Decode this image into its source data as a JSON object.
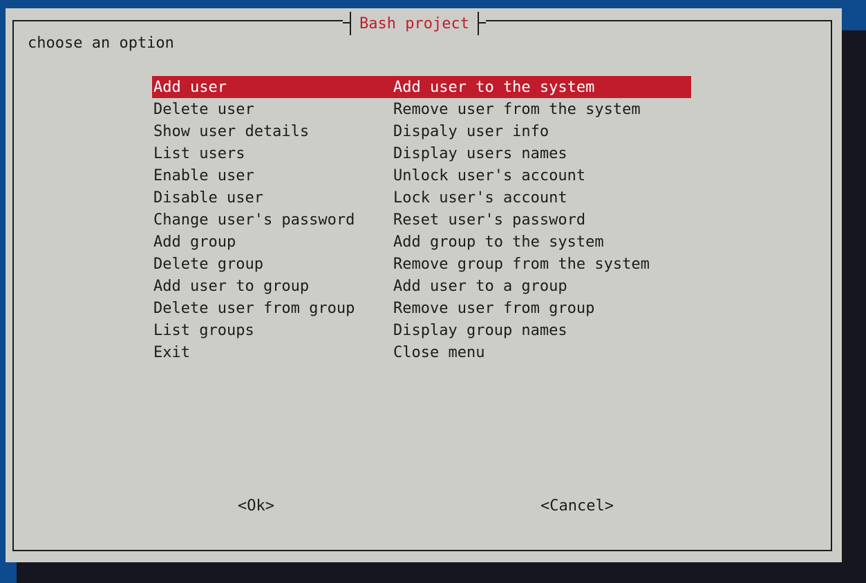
{
  "dialog": {
    "title": "Bash project",
    "prompt": "choose an option"
  },
  "menu": {
    "selected_index": 0,
    "items": [
      {
        "tag": "Add user",
        "description": "Add user to the system"
      },
      {
        "tag": "Delete user",
        "description": "Remove user from the system"
      },
      {
        "tag": "Show user details",
        "description": "Dispaly user info"
      },
      {
        "tag": "List users",
        "description": "Display users names"
      },
      {
        "tag": "Enable user",
        "description": "Unlock user's account"
      },
      {
        "tag": "Disable user",
        "description": "Lock user's account"
      },
      {
        "tag": "Change user's password",
        "description": "Reset user's password"
      },
      {
        "tag": "Add group",
        "description": "Add group to the system"
      },
      {
        "tag": "Delete group",
        "description": "Remove group from the system"
      },
      {
        "tag": "Add user to group",
        "description": "Add user to a group"
      },
      {
        "tag": "Delete user from group",
        "description": "Remove user from group"
      },
      {
        "tag": "List groups",
        "description": "Display group names"
      },
      {
        "tag": "Exit",
        "description": "Close menu"
      }
    ]
  },
  "buttons": {
    "ok_label": "<Ok>",
    "cancel_label": "<Cancel>"
  },
  "colors": {
    "background": "#0e4a8e",
    "dialog": "#cdcdc8",
    "shadow": "#15161f",
    "accent": "#c01c2c",
    "text": "#1c1c1c"
  }
}
